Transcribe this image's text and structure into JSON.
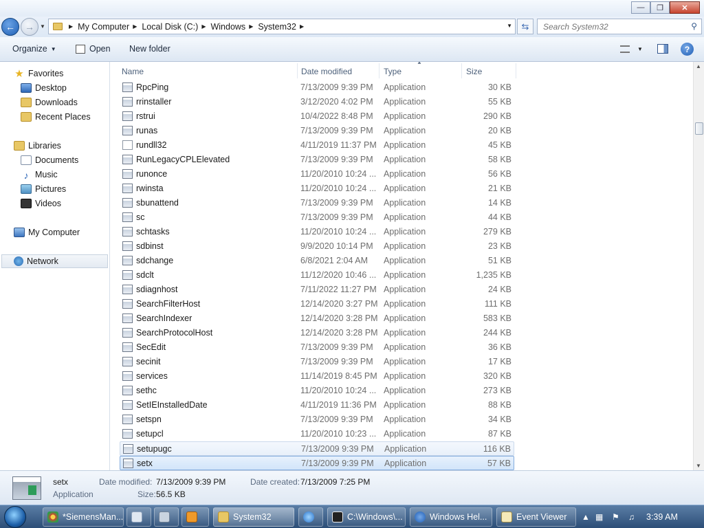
{
  "window": {
    "min": "—",
    "max": "❐",
    "close": "✕"
  },
  "address": {
    "crumbs": [
      "My Computer",
      "Local Disk (C:)",
      "Windows",
      "System32"
    ],
    "search_placeholder": "Search System32"
  },
  "toolbar": {
    "organize": "Organize",
    "open": "Open",
    "new_folder": "New folder",
    "help": "?"
  },
  "nav": {
    "favorites": "Favorites",
    "desktop": "Desktop",
    "downloads": "Downloads",
    "recent": "Recent Places",
    "libraries": "Libraries",
    "documents": "Documents",
    "music": "Music",
    "pictures": "Pictures",
    "videos": "Videos",
    "computer": "My Computer",
    "network": "Network"
  },
  "columns": {
    "name": "Name",
    "date": "Date modified",
    "type": "Type",
    "size": "Size"
  },
  "files": [
    {
      "name": "RpcPing",
      "date": "7/13/2009 9:39 PM",
      "type": "Application",
      "size": "30 KB"
    },
    {
      "name": "rrinstaller",
      "date": "3/12/2020 4:02 PM",
      "type": "Application",
      "size": "55 KB"
    },
    {
      "name": "rstrui",
      "date": "10/4/2022 8:48 PM",
      "type": "Application",
      "size": "290 KB"
    },
    {
      "name": "runas",
      "date": "7/13/2009 9:39 PM",
      "type": "Application",
      "size": "20 KB"
    },
    {
      "name": "rundll32",
      "date": "4/11/2019 11:37 PM",
      "type": "Application",
      "size": "45 KB"
    },
    {
      "name": "RunLegacyCPLElevated",
      "date": "7/13/2009 9:39 PM",
      "type": "Application",
      "size": "58 KB"
    },
    {
      "name": "runonce",
      "date": "11/20/2010 10:24 ...",
      "type": "Application",
      "size": "56 KB"
    },
    {
      "name": "rwinsta",
      "date": "11/20/2010 10:24 ...",
      "type": "Application",
      "size": "21 KB"
    },
    {
      "name": "sbunattend",
      "date": "7/13/2009 9:39 PM",
      "type": "Application",
      "size": "14 KB"
    },
    {
      "name": "sc",
      "date": "7/13/2009 9:39 PM",
      "type": "Application",
      "size": "44 KB"
    },
    {
      "name": "schtasks",
      "date": "11/20/2010 10:24 ...",
      "type": "Application",
      "size": "279 KB"
    },
    {
      "name": "sdbinst",
      "date": "9/9/2020 10:14 PM",
      "type": "Application",
      "size": "23 KB"
    },
    {
      "name": "sdchange",
      "date": "6/8/2021 2:04 AM",
      "type": "Application",
      "size": "51 KB"
    },
    {
      "name": "sdclt",
      "date": "11/12/2020 10:46 ...",
      "type": "Application",
      "size": "1,235 KB"
    },
    {
      "name": "sdiagnhost",
      "date": "7/11/2022 11:27 PM",
      "type": "Application",
      "size": "24 KB"
    },
    {
      "name": "SearchFilterHost",
      "date": "12/14/2020 3:27 PM",
      "type": "Application",
      "size": "111 KB"
    },
    {
      "name": "SearchIndexer",
      "date": "12/14/2020 3:28 PM",
      "type": "Application",
      "size": "583 KB"
    },
    {
      "name": "SearchProtocolHost",
      "date": "12/14/2020 3:28 PM",
      "type": "Application",
      "size": "244 KB"
    },
    {
      "name": "SecEdit",
      "date": "7/13/2009 9:39 PM",
      "type": "Application",
      "size": "36 KB"
    },
    {
      "name": "secinit",
      "date": "7/13/2009 9:39 PM",
      "type": "Application",
      "size": "17 KB"
    },
    {
      "name": "services",
      "date": "11/14/2019 8:45 PM",
      "type": "Application",
      "size": "320 KB"
    },
    {
      "name": "sethc",
      "date": "11/20/2010 10:24 ...",
      "type": "Application",
      "size": "273 KB"
    },
    {
      "name": "SetIEInstalledDate",
      "date": "4/11/2019 11:36 PM",
      "type": "Application",
      "size": "88 KB"
    },
    {
      "name": "setspn",
      "date": "7/13/2009 9:39 PM",
      "type": "Application",
      "size": "34 KB"
    },
    {
      "name": "setupcl",
      "date": "11/20/2010 10:23 ...",
      "type": "Application",
      "size": "87 KB"
    },
    {
      "name": "setupugc",
      "date": "7/13/2009 9:39 PM",
      "type": "Application",
      "size": "116 KB"
    },
    {
      "name": "setx",
      "date": "7/13/2009 9:39 PM",
      "type": "Application",
      "size": "57 KB"
    }
  ],
  "details": {
    "name": "setx",
    "type": "Application",
    "modified_label": "Date modified:",
    "modified": "7/13/2009 9:39 PM",
    "created_label": "Date created:",
    "created": "7/13/2009 7:25 PM",
    "size_label": "Size:",
    "size": "56.5 KB"
  },
  "taskbar": {
    "items": [
      "*SiemensMan...",
      "System32",
      "C:\\Windows\\...",
      "Windows Hel...",
      "Event Viewer"
    ],
    "clock": "3:39 AM"
  },
  "colors": {
    "accent": "#1f5fb4",
    "taskbar": "#2c4e77",
    "selection": "#d2e5fa"
  }
}
